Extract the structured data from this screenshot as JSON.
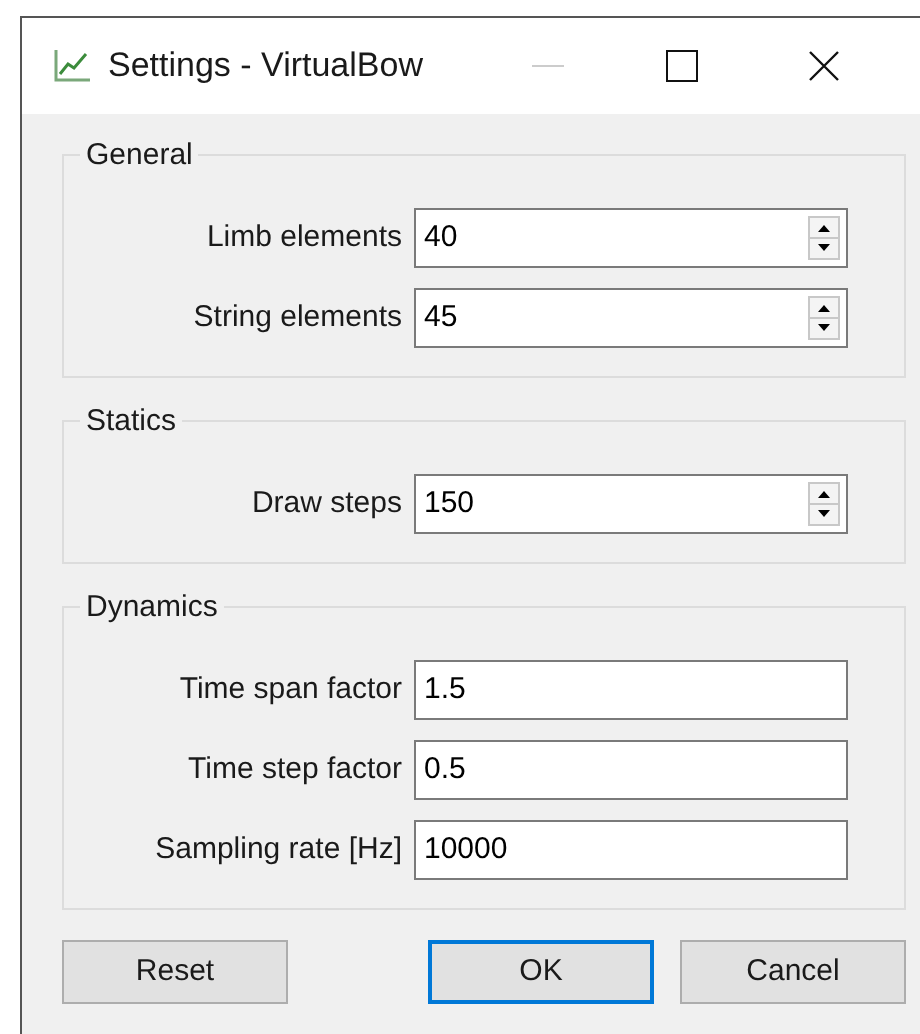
{
  "window": {
    "title": "Settings - VirtualBow"
  },
  "groups": [
    {
      "title": "General",
      "fields": [
        {
          "label": "Limb elements",
          "value": "40",
          "kind": "spin"
        },
        {
          "label": "String elements",
          "value": "45",
          "kind": "spin"
        }
      ]
    },
    {
      "title": "Statics",
      "fields": [
        {
          "label": "Draw steps",
          "value": "150",
          "kind": "spin"
        }
      ]
    },
    {
      "title": "Dynamics",
      "fields": [
        {
          "label": "Time span factor",
          "value": "1.5",
          "kind": "text"
        },
        {
          "label": "Time step factor",
          "value": "0.5",
          "kind": "text"
        },
        {
          "label": "Sampling rate [Hz]",
          "value": "10000",
          "kind": "text"
        }
      ]
    }
  ],
  "buttons": [
    {
      "label": "Reset",
      "default": false
    },
    {
      "label": "OK",
      "default": true
    },
    {
      "label": "Cancel",
      "default": false
    }
  ]
}
